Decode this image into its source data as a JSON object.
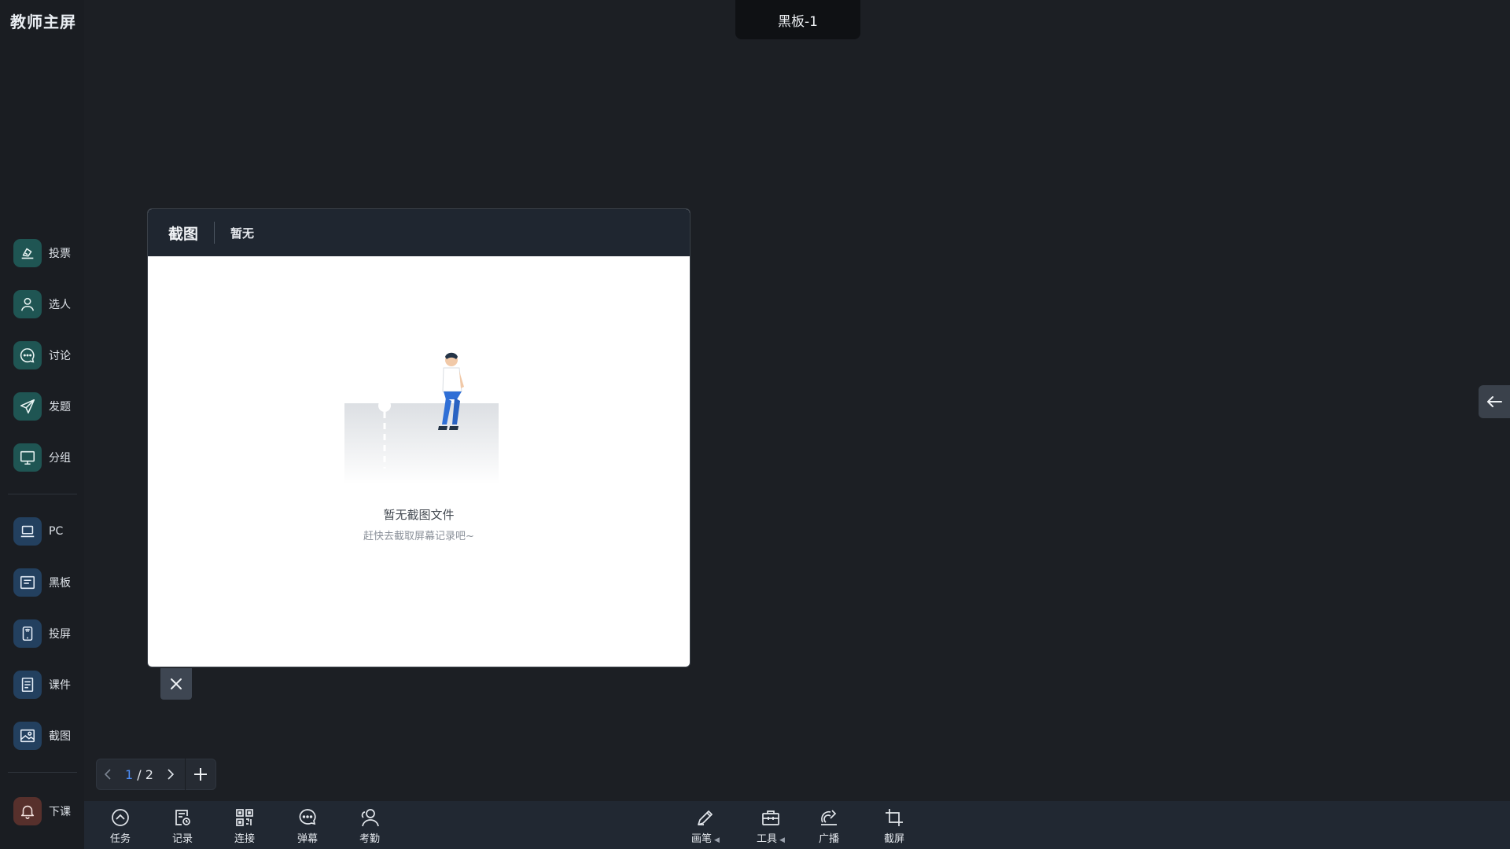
{
  "app": {
    "title": "教师主屏"
  },
  "board_tab": {
    "label": "黑板-1"
  },
  "sidebar": {
    "top_items": [
      {
        "label": "投票",
        "icon": "vote-icon",
        "color": "#1f5553"
      },
      {
        "label": "选人",
        "icon": "person-icon",
        "color": "#1f5553"
      },
      {
        "label": "讨论",
        "icon": "chat-icon",
        "color": "#1f5553"
      },
      {
        "label": "发题",
        "icon": "send-icon",
        "color": "#1f5553"
      },
      {
        "label": "分组",
        "icon": "monitor-icon",
        "color": "#1f5553"
      }
    ],
    "mid_items": [
      {
        "label": "PC",
        "icon": "laptop-icon",
        "color": "#23405f"
      },
      {
        "label": "黑板",
        "icon": "board-icon",
        "color": "#23405f"
      },
      {
        "label": "投屏",
        "icon": "cast-phone-icon",
        "color": "#23405f"
      },
      {
        "label": "课件",
        "icon": "courseware-icon",
        "color": "#23405f"
      },
      {
        "label": "截图",
        "icon": "image-icon",
        "color": "#23405f"
      }
    ],
    "end_class": {
      "label": "下课",
      "icon": "bell-icon",
      "color": "#57302c"
    }
  },
  "dialog": {
    "title": "截图",
    "subtitle": "暂无",
    "empty_title": "暂无截图文件",
    "empty_sub": "赶快去截取屏幕记录吧~"
  },
  "pager": {
    "current": "1",
    "separator": "/",
    "total": "2"
  },
  "toolbar": {
    "left": [
      {
        "label": "任务",
        "icon": "task-icon"
      },
      {
        "label": "记录",
        "icon": "record-icon"
      },
      {
        "label": "连接",
        "icon": "qrcode-icon"
      },
      {
        "label": "弹幕",
        "icon": "danmaku-icon"
      },
      {
        "label": "考勤",
        "icon": "attendance-icon"
      }
    ],
    "right": [
      {
        "label": "画笔",
        "icon": "pen-icon",
        "has_caret": true
      },
      {
        "label": "工具",
        "icon": "toolbox-icon",
        "has_caret": true
      },
      {
        "label": "广播",
        "icon": "broadcast-icon",
        "has_caret": false
      },
      {
        "label": "截屏",
        "icon": "crop-icon",
        "has_caret": false
      }
    ]
  },
  "colors": {
    "background": "#1c1f24",
    "accent": "#4d8ef7",
    "dialog_header": "#1f2630"
  }
}
